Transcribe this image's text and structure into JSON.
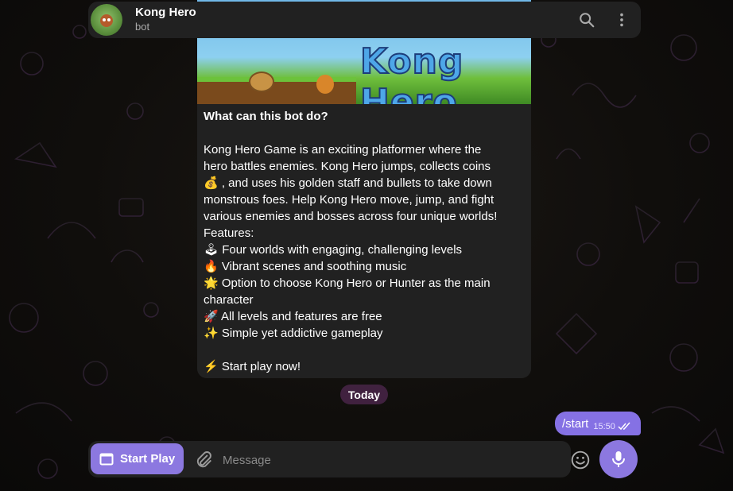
{
  "header": {
    "title": "Kong Hero",
    "subtitle": "bot",
    "search_icon": "search-icon",
    "menu_icon": "more-vert-icon"
  },
  "message": {
    "banner_logo": "Kong Hero",
    "lines": [
      "What can this bot do?",
      "",
      "Kong Hero Game is an exciting platformer where the",
      "hero battles enemies. Kong Hero jumps, collects coins",
      "💰 , and uses his golden staff and bullets to take down",
      "monstrous foes. Help Kong Hero move, jump, and fight",
      "various enemies and bosses across four unique worlds!",
      "Features:",
      "🕹 Four worlds with engaging, challenging levels",
      "🔥 Vibrant scenes and soothing music",
      "🌟 Option to choose Kong Hero or Hunter as the main",
      "character",
      "🚀 All levels and features are free",
      "✨ Simple yet addictive gameplay",
      "",
      "⚡ Start play now!"
    ]
  },
  "date_separator": "Today",
  "outgoing": {
    "text": "/start",
    "time": "15:50"
  },
  "composer": {
    "start_play_label": "Start Play",
    "placeholder": "Message"
  },
  "colors": {
    "accent": "#8c78e0",
    "bubble_out": "#8571e4",
    "panel": "#212121"
  }
}
